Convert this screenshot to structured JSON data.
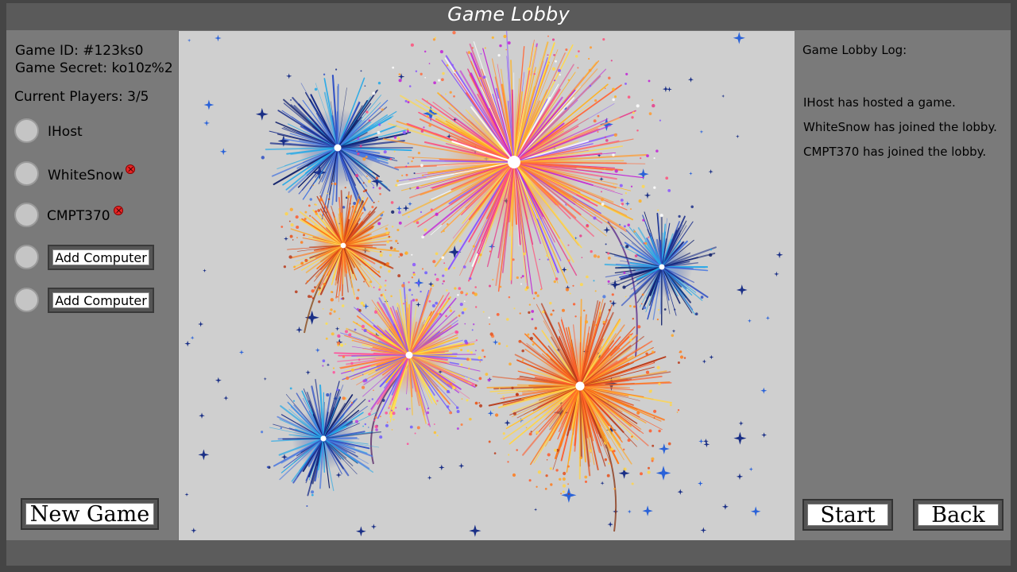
{
  "window": {
    "title": "Game Lobby"
  },
  "game": {
    "id_label": "Game ID: #123ks0",
    "secret_label": "Game Secret: ko10z%2",
    "players_label": "Current Players: 3/5"
  },
  "players": [
    {
      "name": "IHost",
      "kickable": false
    },
    {
      "name": "WhiteSnow",
      "kickable": true
    },
    {
      "name": "CMPT370",
      "kickable": true
    }
  ],
  "empty_slots": [
    {
      "button_label": "Add Computer"
    },
    {
      "button_label": "Add Computer"
    }
  ],
  "buttons": {
    "new_game": "New Game",
    "start": "Start",
    "back": "Back"
  },
  "log": {
    "header": "Game Lobby Log:",
    "entries": [
      "IHost has hosted a game.",
      "WhiteSnow has joined the lobby.",
      "CMPT370 has joined the lobby."
    ]
  },
  "colors": {
    "frame": "#454545",
    "panel": "#7a7a7a",
    "canvas": "#cfcfcf",
    "kick": "#e62525",
    "star": "#1a3a9a"
  },
  "icons": {
    "kick": "kick-player-icon",
    "fireworks": "fireworks-image"
  }
}
